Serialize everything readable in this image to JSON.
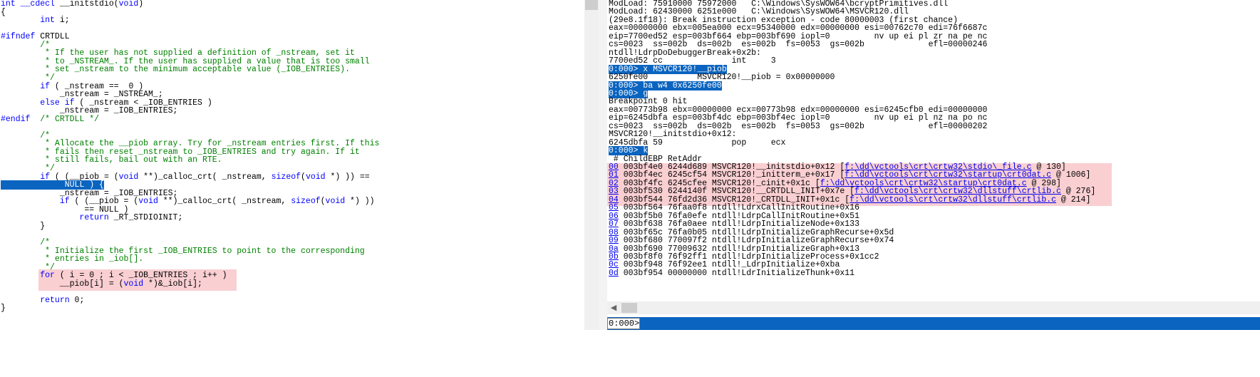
{
  "source": {
    "lines": [
      [
        {
          "t": "int",
          "c": "kw"
        },
        {
          "t": " "
        },
        {
          "t": "__cdecl",
          "c": "kw"
        },
        {
          "t": " __initstdio("
        },
        {
          "t": "void",
          "c": "kw"
        },
        {
          "t": ")"
        }
      ],
      [
        {
          "t": "{"
        }
      ],
      [
        {
          "t": "        "
        },
        {
          "t": "int",
          "c": "kw"
        },
        {
          "t": " i;"
        }
      ],
      [
        {
          "t": ""
        }
      ],
      [
        {
          "t": "#ifndef",
          "c": "kw"
        },
        {
          "t": " CRTDLL"
        }
      ],
      [
        {
          "t": "        /*",
          "c": "cm"
        }
      ],
      [
        {
          "t": "         * If the user has not supplied a definition of _nstream, set it",
          "c": "cm"
        }
      ],
      [
        {
          "t": "         * to _NSTREAM_. If the user has supplied a value that is too small",
          "c": "cm"
        }
      ],
      [
        {
          "t": "         * set _nstream to the minimum acceptable value (_IOB_ENTRIES).",
          "c": "cm"
        }
      ],
      [
        {
          "t": "         */",
          "c": "cm"
        }
      ],
      [
        {
          "t": "        "
        },
        {
          "t": "if",
          "c": "kw"
        },
        {
          "t": " ( _nstream ==  0 )"
        }
      ],
      [
        {
          "t": "            _nstream = _NSTREAM_;"
        }
      ],
      [
        {
          "t": "        "
        },
        {
          "t": "else if",
          "c": "kw"
        },
        {
          "t": " ( _nstream < _IOB_ENTRIES )"
        }
      ],
      [
        {
          "t": "            _nstream = _IOB_ENTRIES;"
        }
      ],
      [
        {
          "t": "#endif",
          "c": "kw"
        },
        {
          "t": "  "
        },
        {
          "t": "/* CRTDLL */",
          "c": "cm"
        }
      ],
      [
        {
          "t": ""
        }
      ],
      [
        {
          "t": "        /*",
          "c": "cm"
        }
      ],
      [
        {
          "t": "         * Allocate the __piob array. Try for _nstream entries first. If this",
          "c": "cm"
        }
      ],
      [
        {
          "t": "         * fails then reset _nstream to _IOB_ENTRIES and try again. If it",
          "c": "cm"
        }
      ],
      [
        {
          "t": "         * still fails, bail out with an RTE.",
          "c": "cm"
        }
      ],
      [
        {
          "t": "         */",
          "c": "cm"
        }
      ],
      [
        {
          "t": "        "
        },
        {
          "t": "if",
          "c": "kw"
        },
        {
          "t": " ( (__piob = ("
        },
        {
          "t": "void",
          "c": "kw"
        },
        {
          "t": " **)_calloc_crt( _nstream, "
        },
        {
          "t": "sizeof",
          "c": "kw"
        },
        {
          "t": "("
        },
        {
          "t": "void",
          "c": "kw"
        },
        {
          "t": " *) )) =="
        }
      ],
      [
        {
          "t": "             NULL ) {",
          "c": "sel"
        }
      ],
      [
        {
          "t": "            _nstream = _IOB_ENTRIES;"
        }
      ],
      [
        {
          "t": "            "
        },
        {
          "t": "if",
          "c": "kw"
        },
        {
          "t": " ( (__piob = ("
        },
        {
          "t": "void",
          "c": "kw"
        },
        {
          "t": " **)_calloc_crt( _nstream, "
        },
        {
          "t": "sizeof",
          "c": "kw"
        },
        {
          "t": "("
        },
        {
          "t": "void",
          "c": "kw"
        },
        {
          "t": " *) ))"
        }
      ],
      [
        {
          "t": "                 == NULL )"
        }
      ],
      [
        {
          "t": "                "
        },
        {
          "t": "return",
          "c": "kw"
        },
        {
          "t": " _RT_STDIOINIT;"
        }
      ],
      [
        {
          "t": "        }"
        }
      ],
      [
        {
          "t": ""
        }
      ],
      [
        {
          "t": "        /*",
          "c": "cm"
        }
      ],
      [
        {
          "t": "         * Initialize the first _IOB_ENTRIES to point to the corresponding",
          "c": "cm"
        }
      ],
      [
        {
          "t": "         * entries in _iob[].",
          "c": "cm"
        }
      ],
      [
        {
          "t": "         */",
          "c": "cm"
        }
      ],
      [
        {
          "t": "        "
        },
        {
          "t": "for",
          "c": "kw"
        },
        {
          "t": " ( i = 0 ; i < _IOB_ENTRIES ; i++ )"
        }
      ],
      [
        {
          "t": "            __piob[i] = ("
        },
        {
          "t": "void",
          "c": "kw"
        },
        {
          "t": " *)&_iob[i];"
        }
      ],
      [
        {
          "t": ""
        }
      ],
      [
        {
          "t": "        "
        },
        {
          "t": "return",
          "c": "kw"
        },
        {
          "t": " 0;"
        }
      ],
      [
        {
          "t": "}"
        }
      ]
    ]
  },
  "debugger": {
    "lines": [
      [
        {
          "t": "ModLoad: 75910000 75972000   C:\\Windows\\SysWOW64\\bcryptPrimitives.dll"
        }
      ],
      [
        {
          "t": "ModLoad: 62430000 6251e000   C:\\Windows\\SysWOW64\\MSVCR120.dll"
        }
      ],
      [
        {
          "t": "(29e8.1f18): Break instruction exception - code 80000003 (first chance)"
        }
      ],
      [
        {
          "t": "eax=00000000 ebx=005ea000 ecx=95340000 edx=00000000 esi=00762c70 edi=76f6687c"
        }
      ],
      [
        {
          "t": "eip=7700ed52 esp=003bf664 ebp=003bf690 iopl=0         nv up ei pl zr na pe nc"
        }
      ],
      [
        {
          "t": "cs=0023  ss=002b  ds=002b  es=002b  fs=0053  gs=002b             efl=00000246"
        }
      ],
      [
        {
          "t": "ntdll!LdrpDoDebuggerBreak+0x2b:"
        }
      ],
      [
        {
          "t": "7700ed52 cc              int     3"
        }
      ],
      [
        {
          "t": "0:000> x MSVCR120!__piob",
          "c": "cmd"
        }
      ],
      [
        {
          "t": "6250fe00          MSVCR120!__piob = 0x00000000"
        }
      ],
      [
        {
          "t": "0:000> ba w4 0x6250fe00",
          "c": "cmd"
        }
      ],
      [
        {
          "t": "0:000> g",
          "c": "cmd"
        }
      ],
      [
        {
          "t": "Breakpoint 0 hit"
        }
      ],
      [
        {
          "t": "eax=00773b98 ebx=00000000 ecx=00773b98 edx=00000000 esi=6245cfb0 edi=00000000"
        }
      ],
      [
        {
          "t": "eip=6245dbfa esp=003bf4dc ebp=003bf4ec iopl=0         nv up ei pl nz na po nc"
        }
      ],
      [
        {
          "t": "cs=0023  ss=002b  ds=002b  es=002b  fs=0053  gs=002b             efl=00000202"
        }
      ],
      [
        {
          "t": "MSVCR120!__initstdio+0x12:"
        }
      ],
      [
        {
          "t": "6245dbfa 59              pop     ecx"
        }
      ],
      [
        {
          "t": "0:000> k",
          "c": "cmd"
        }
      ],
      [
        {
          "t": " # ChildEBP RetAddr"
        }
      ],
      [
        {
          "t": "00",
          "c": "lnk"
        },
        {
          "t": " 003bf4e0 6244d689 MSVCR120!__initstdio+0x12 ["
        },
        {
          "t": "f:\\dd\\vctools\\crt\\crtw32\\stdio\\_file.c",
          "c": "lnk"
        },
        {
          "t": " @ 130]"
        }
      ],
      [
        {
          "t": "01",
          "c": "lnk"
        },
        {
          "t": " 003bf4ec 6245cf54 MSVCR120!_initterm_e+0x17 ["
        },
        {
          "t": "f:\\dd\\vctools\\crt\\crtw32\\startup\\crt0dat.c",
          "c": "lnk"
        },
        {
          "t": " @ 1006]"
        }
      ],
      [
        {
          "t": "02",
          "c": "lnk"
        },
        {
          "t": " 003bf4fc 6245cfee MSVCR120!_cinit+0x1c ["
        },
        {
          "t": "f:\\dd\\vctools\\crt\\crtw32\\startup\\crt0dat.c",
          "c": "lnk"
        },
        {
          "t": " @ 298]"
        }
      ],
      [
        {
          "t": "03",
          "c": "lnk"
        },
        {
          "t": " 003bf530 6244140f MSVCR120!__CRTDLL_INIT+0x7e ["
        },
        {
          "t": "f:\\dd\\vctools\\crt\\crtw32\\dllstuff\\crtlib.c",
          "c": "lnk"
        },
        {
          "t": " @ 276]"
        }
      ],
      [
        {
          "t": "04",
          "c": "lnk"
        },
        {
          "t": " 003bf544 76fd2d36 MSVCR120!_CRTDLL_INIT+0x1c ["
        },
        {
          "t": "f:\\dd\\vctools\\crt\\crtw32\\dllstuff\\crtlib.c",
          "c": "lnk"
        },
        {
          "t": " @ 214]"
        }
      ],
      [
        {
          "t": "05",
          "c": "lnk"
        },
        {
          "t": " 003bf564 76faa0f8 ntdll!LdrxCallInitRoutine+0x16"
        }
      ],
      [
        {
          "t": "06",
          "c": "lnk"
        },
        {
          "t": " 003bf5b0 76fa0efe ntdll!LdrpCallInitRoutine+0x51"
        }
      ],
      [
        {
          "t": "07",
          "c": "lnk"
        },
        {
          "t": " 003bf638 76fa0aee ntdll!LdrpInitializeNode+0x133"
        }
      ],
      [
        {
          "t": "08",
          "c": "lnk"
        },
        {
          "t": " 003bf65c 76fa0b05 ntdll!LdrpInitializeGraphRecurse+0x5d"
        }
      ],
      [
        {
          "t": "09",
          "c": "lnk"
        },
        {
          "t": " 003bf680 770097f2 ntdll!LdrpInitializeGraphRecurse+0x74"
        }
      ],
      [
        {
          "t": "0a",
          "c": "lnk"
        },
        {
          "t": " 003bf690 77009632 ntdll!LdrpInitializeGraph+0x13"
        }
      ],
      [
        {
          "t": "0b",
          "c": "lnk"
        },
        {
          "t": " 003bf8f0 76f92ff1 ntdll!LdrpInitializeProcess+0x1cc2"
        }
      ],
      [
        {
          "t": "0c",
          "c": "lnk"
        },
        {
          "t": " 003bf948 76f92ee1 ntdll!_LdrpInitialize+0xba"
        }
      ],
      [
        {
          "t": "0d",
          "c": "lnk"
        },
        {
          "t": " 003bf954 00000000 ntdll!LdrInitializeThunk+0x11"
        }
      ]
    ]
  },
  "command": {
    "prompt": "0:000>"
  },
  "colors": {
    "selection": "#0a64c0",
    "highlight": "#f9cfd2",
    "keyword": "#0000ff",
    "comment": "#008000"
  }
}
